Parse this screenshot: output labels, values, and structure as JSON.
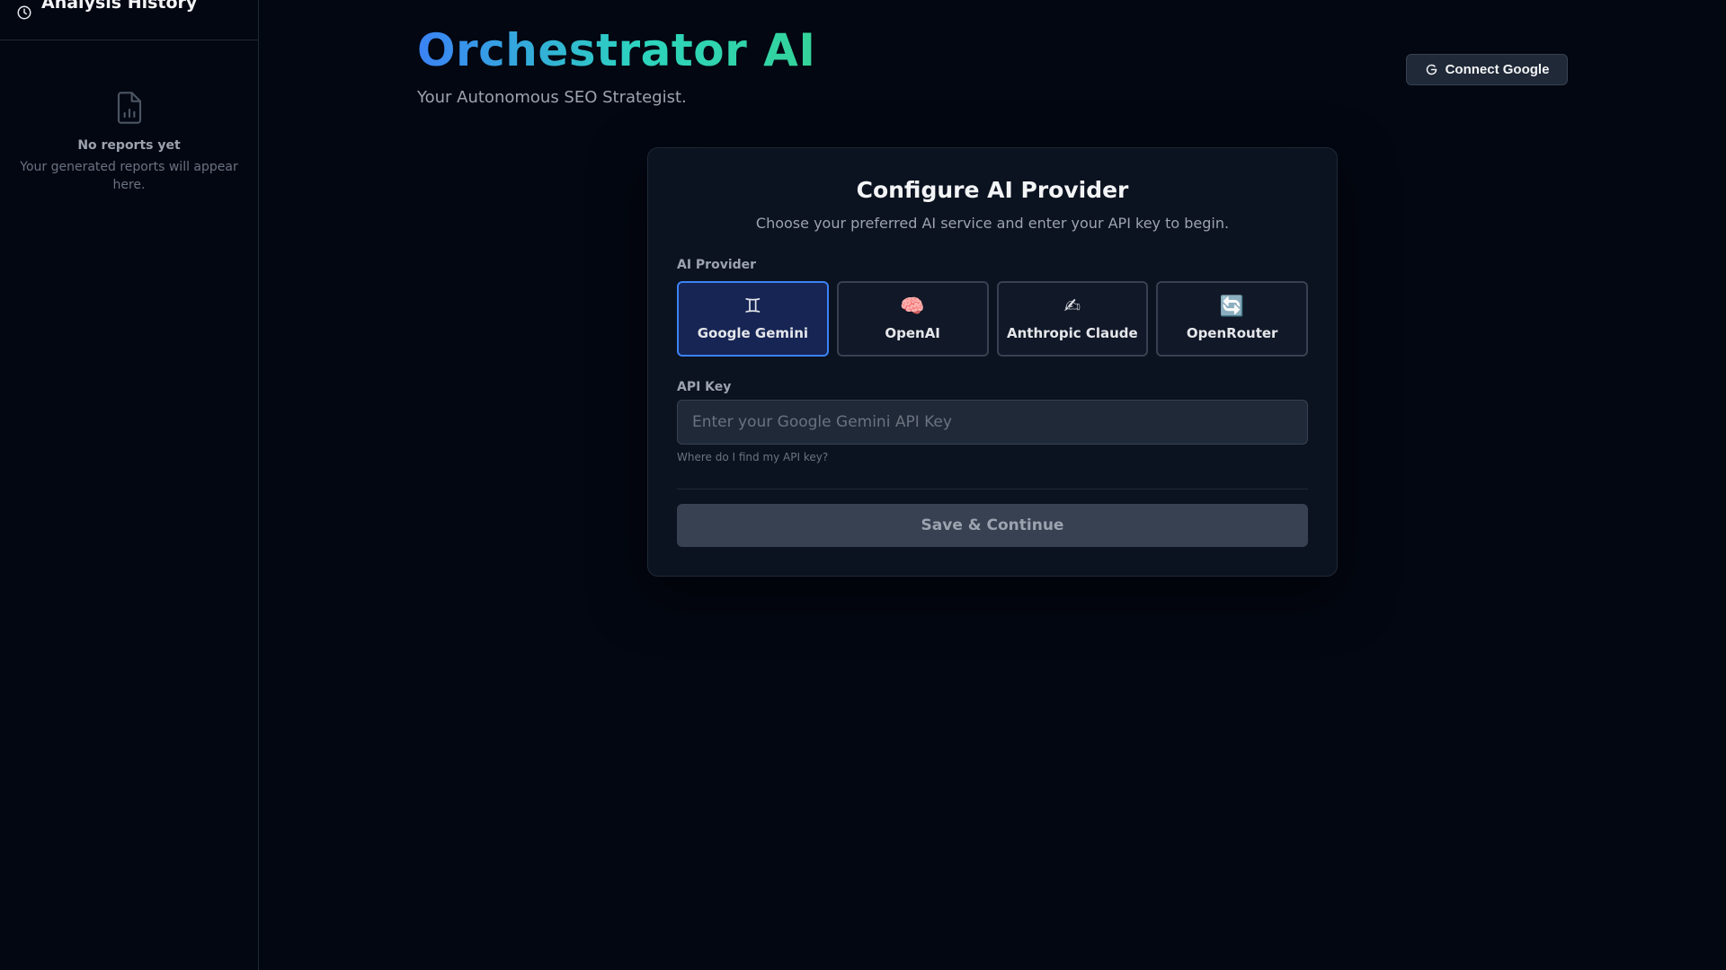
{
  "sidebar": {
    "title": "Analysis History",
    "title_icon": "clock-icon",
    "empty_icon": "report-file-icon",
    "empty_title": "No reports yet",
    "empty_subtitle": "Your generated reports will appear here."
  },
  "header": {
    "brand": "Orchestrator AI",
    "tagline": "Your Autonomous SEO Strategist.",
    "connect_label": "Connect Google",
    "connect_icon": "google-g-icon"
  },
  "card": {
    "title": "Configure AI Provider",
    "subtitle": "Choose your preferred AI service and enter your API key to begin.",
    "provider_label": "AI Provider",
    "providers": [
      {
        "label": "Google Gemini",
        "icon": "♊",
        "icon_name": "gemini-icon",
        "selected": true
      },
      {
        "label": "OpenAI",
        "icon": "🧠",
        "icon_name": "brain-icon",
        "selected": false
      },
      {
        "label": "Anthropic Claude",
        "icon": "✍",
        "icon_name": "writing-hand-icon",
        "selected": false
      },
      {
        "label": "OpenRouter",
        "icon": "🔄",
        "icon_name": "refresh-icon",
        "selected": false
      }
    ],
    "key_label": "API Key",
    "key_placeholder": "Enter your Google Gemini API Key",
    "key_value": "",
    "help_link": "Where do I find my API key?",
    "save_label": "Save & Continue"
  },
  "colors": {
    "background": "#030712",
    "accent": "#3b82f6",
    "brand_gradient_start": "#3b82f6",
    "brand_gradient_end": "#34d399"
  }
}
